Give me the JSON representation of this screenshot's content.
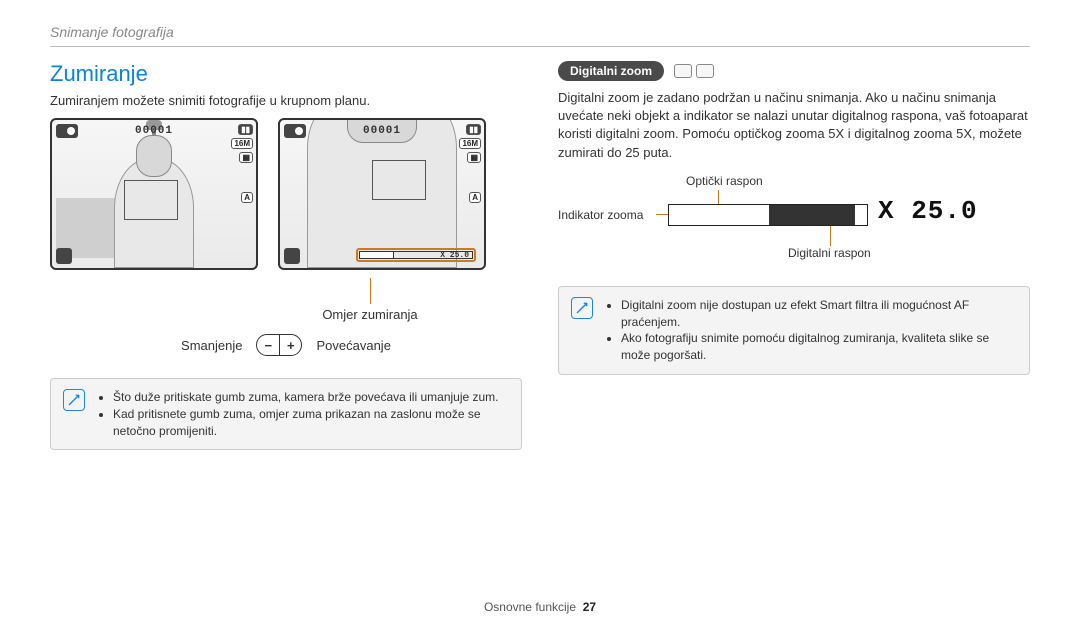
{
  "header": {
    "section": "Snimanje fotografija"
  },
  "left": {
    "title": "Zumiranje",
    "intro": "Zumiranjem možete snimiti fotografije u krupnom planu.",
    "screen": {
      "counter": "00001",
      "size_badge": "16M",
      "flash_badge": "A",
      "zoom_readout": "X 25.0"
    },
    "annot_ratio": "Omjer zumiranja",
    "decrease": "Smanjenje",
    "increase": "Povećavanje",
    "notes": [
      "Što duže pritiskate gumb zuma, kamera brže povećava ili umanjuje zum.",
      "Kad pritisnete gumb zuma, omjer zuma prikazan na zaslonu može se netočno promijeniti."
    ]
  },
  "right": {
    "chip": "Digitalni zoom",
    "body": "Digitalni zoom je zadano podržan u načinu snimanja. Ako u načinu snimanja uvećate neki objekt a indikator se nalazi unutar digitalnog raspona, vaš fotoaparat koristi digitalni zoom. Pomoću optičkog zooma 5X i digitalnog zooma 5X, možete zumirati do 25 puta.",
    "labels": {
      "optical": "Optički raspon",
      "indicator": "Indikator zooma",
      "digital": "Digitalni raspon",
      "x": "X 25.0"
    },
    "notes": [
      "Digitalni zoom nije dostupan uz efekt Smart filtra ili mogućnost AF praćenjem.",
      "Ako fotografiju snimite pomoću digitalnog zumiranja, kvaliteta slike se može pogoršati."
    ]
  },
  "footer": {
    "label": "Osnovne funkcije",
    "page": "27"
  }
}
